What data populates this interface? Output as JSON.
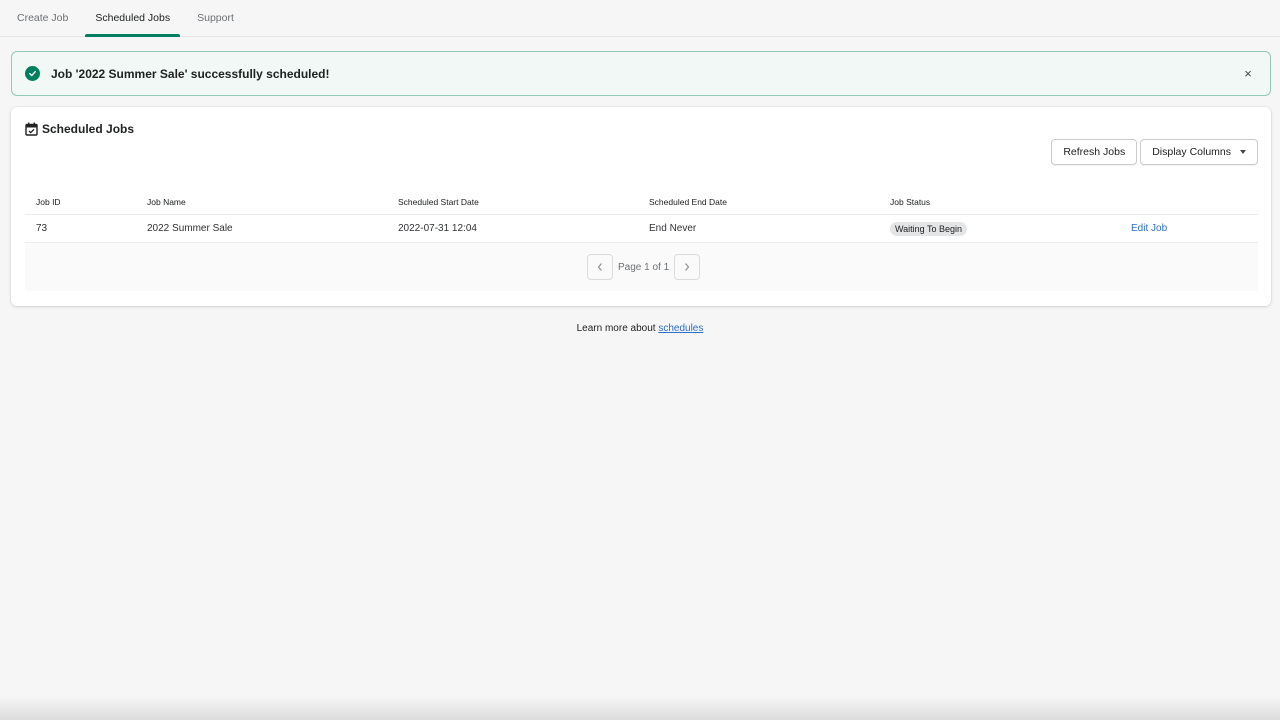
{
  "tabs": [
    {
      "label": "Create Job",
      "active": false
    },
    {
      "label": "Scheduled Jobs",
      "active": true
    },
    {
      "label": "Support",
      "active": false
    }
  ],
  "banner": {
    "message": "Job '2022 Summer Sale' successfully scheduled!",
    "status": "success",
    "icon": "check-circle-icon",
    "close_label": "×"
  },
  "card": {
    "title": "Scheduled Jobs",
    "title_icon": "calendar-check-icon",
    "actions": {
      "refresh_label": "Refresh Jobs",
      "display_columns_label": "Display Columns"
    },
    "table": {
      "columns": [
        "Job ID",
        "Job Name",
        "Scheduled Start Date",
        "Scheduled End Date",
        "Job Status",
        ""
      ],
      "rows": [
        {
          "job_id": "73",
          "job_name": "2022 Summer Sale",
          "start_date": "2022-07-31 12:04",
          "end_date": "End Never",
          "status": "Waiting To Begin",
          "action": "Edit Job"
        }
      ]
    },
    "pagination": {
      "label": "Page 1 of 1",
      "prev_icon": "chevron-left-icon",
      "next_icon": "chevron-right-icon"
    }
  },
  "footer": {
    "text": "Learn more about ",
    "link_text": "schedules"
  },
  "colors": {
    "accent": "#008060",
    "success_bg": "#f1f8f5",
    "success_border": "#95c9b4",
    "link": "#2c6ecb",
    "badge_bg": "#e4e5e7"
  }
}
